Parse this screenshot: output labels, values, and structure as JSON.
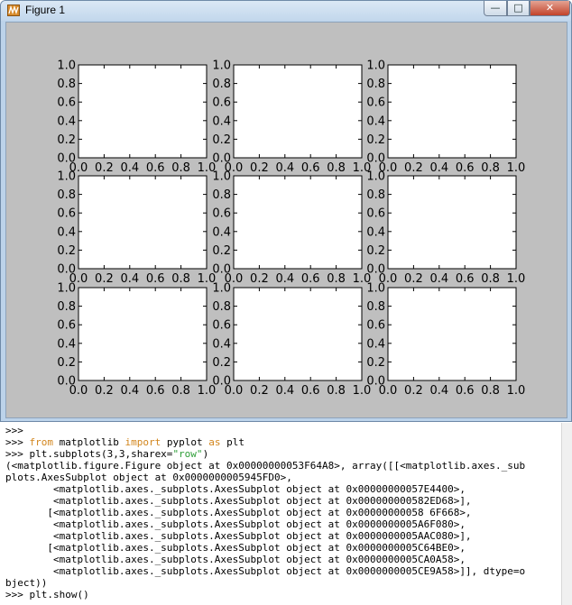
{
  "window": {
    "title": "Figure 1",
    "controls": {
      "minimize": "—",
      "maximize": "□",
      "close": "✕"
    }
  },
  "figure": {
    "grid": {
      "rows": 3,
      "cols": 3
    },
    "y_ticks": [
      "0.0",
      "0.2",
      "0.4",
      "0.6",
      "0.8",
      "1.0"
    ],
    "x_ticks": [
      "0.0",
      "0.2",
      "0.4",
      "0.6",
      "0.8",
      "1.0"
    ],
    "colors": {
      "figure_bg": "#bfbfbf",
      "axes_bg": "#ffffff",
      "frame": "#000000"
    }
  },
  "chart_data": {
    "type": "scatter",
    "grid": false,
    "subplots": 9,
    "xlim": [
      0,
      1
    ],
    "ylim": [
      0,
      1
    ],
    "series": []
  },
  "console": {
    "lines": [
      [
        {
          "t": ">>>"
        }
      ],
      [
        {
          "t": ">>> "
        },
        {
          "t": "from",
          "c": "kw"
        },
        {
          "t": " matplotlib "
        },
        {
          "t": "import",
          "c": "kw"
        },
        {
          "t": " pyplot "
        },
        {
          "t": "as",
          "c": "kw"
        },
        {
          "t": " plt"
        }
      ],
      [
        {
          "t": ">>> plt.subplots(3,3,sharex="
        },
        {
          "t": "\"row\"",
          "c": "str"
        },
        {
          "t": ")"
        }
      ],
      [
        {
          "t": "(<matplotlib.figure.Figure object at 0x00000000053F64A8>, array([[<matplotlib.axes._sub"
        }
      ],
      [
        {
          "t": "plots.AxesSubplot object at 0x0000000005945FD0>,"
        }
      ],
      [
        {
          "t": "        <matplotlib.axes._subplots.AxesSubplot object at 0x00000000057E4400>,"
        }
      ],
      [
        {
          "t": "        <matplotlib.axes._subplots.AxesSubplot object at 0x000000000582ED68>],"
        }
      ],
      [
        {
          "t": "       [<matplotlib.axes._subplots.AxesSubplot object at 0x00000000058 6F668>,"
        }
      ],
      [
        {
          "t": "        <matplotlib.axes._subplots.AxesSubplot object at 0x0000000005A6F080>,"
        }
      ],
      [
        {
          "t": "        <matplotlib.axes._subplots.AxesSubplot object at 0x0000000005AAC080>],"
        }
      ],
      [
        {
          "t": "       [<matplotlib.axes._subplots.AxesSubplot object at 0x0000000005C64BE0>,"
        }
      ],
      [
        {
          "t": "        <matplotlib.axes._subplots.AxesSubplot object at 0x0000000005CA0A58>,"
        }
      ],
      [
        {
          "t": "        <matplotlib.axes._subplots.AxesSubplot object at 0x0000000005CE9A58>]], dtype=o"
        }
      ],
      [
        {
          "t": "bject))"
        }
      ],
      [
        {
          "t": ">>> plt.show()"
        }
      ]
    ]
  }
}
